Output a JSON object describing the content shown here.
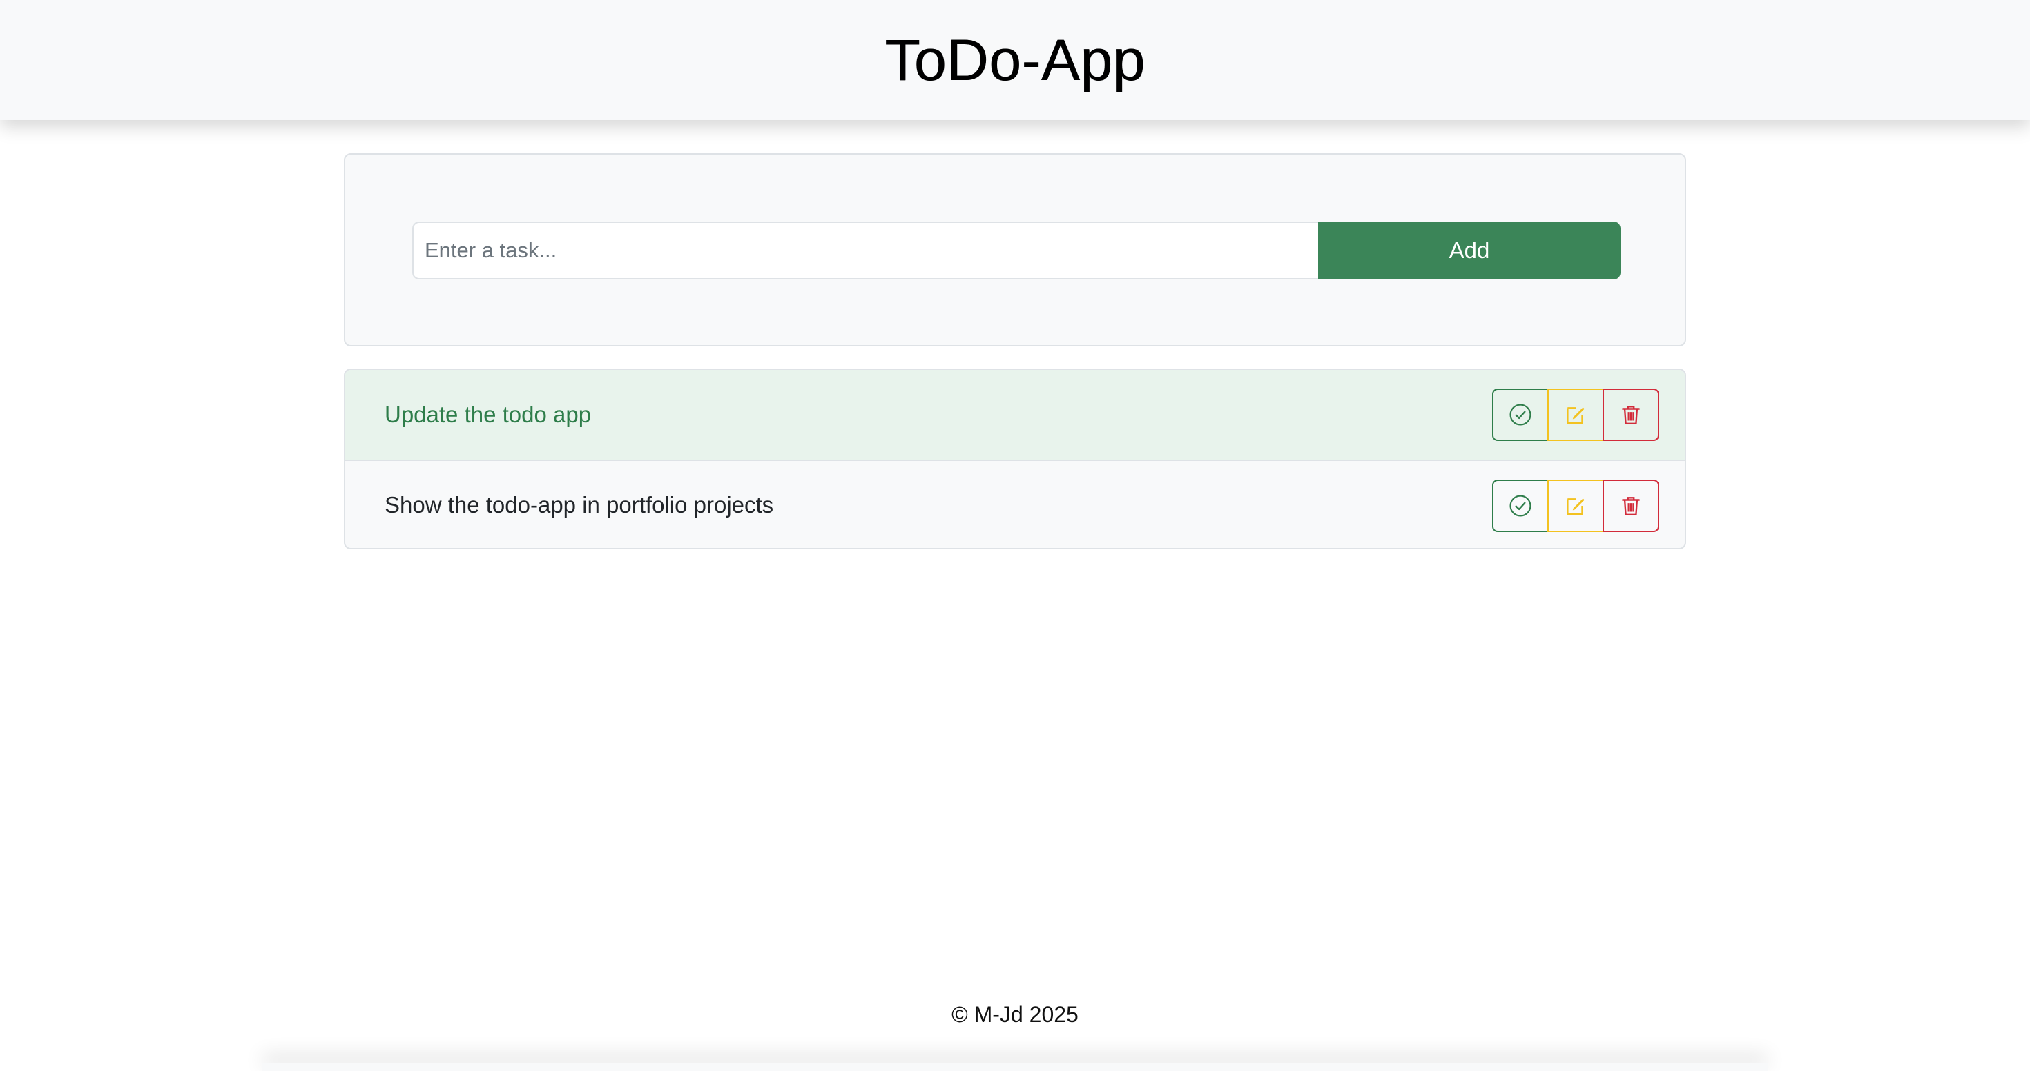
{
  "header": {
    "title": "ToDo-App"
  },
  "input": {
    "placeholder": "Enter a task...",
    "value": ""
  },
  "add_button": {
    "label": "Add"
  },
  "tasks": [
    {
      "text": "Update the todo app",
      "completed": true
    },
    {
      "text": "Show the todo-app in portfolio projects",
      "completed": false
    }
  ],
  "icons": {
    "done": "check-circle-icon",
    "edit": "pencil-square-icon",
    "delete": "trash-icon"
  },
  "colors": {
    "accent": "#3b8558",
    "done": "#2e7d4a",
    "edit": "#f3c220",
    "delete": "#d22b3a",
    "completed_row": "#e8f3ec"
  },
  "footer": {
    "text": "© M-Jd 2025"
  }
}
